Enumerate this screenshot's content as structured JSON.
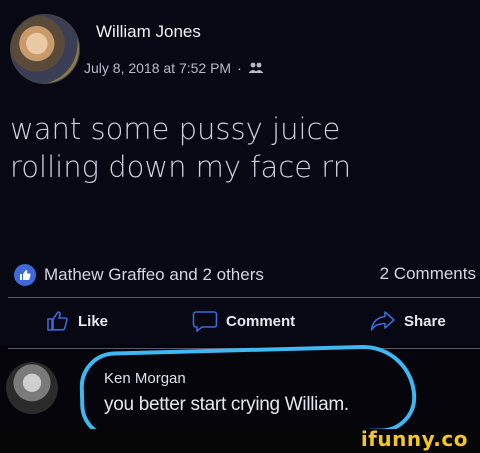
{
  "post": {
    "author": "William Jones",
    "timestamp": "July 8, 2018 at 7:52 PM",
    "separator": "·",
    "audience_icon": "friends-icon",
    "text_line1": "want some pussy juice",
    "text_line2": "rolling down my face rn"
  },
  "reactions": {
    "icon": "like-icon",
    "summary": "Mathew Graffeo and 2 others",
    "comments_count": "2 Comments"
  },
  "actions": {
    "like": "Like",
    "comment": "Comment",
    "share": "Share"
  },
  "comment": {
    "author": "Ken Morgan",
    "text": "you better start crying William."
  },
  "watermark": "ifunny.co",
  "colors": {
    "background": "#080814",
    "like_badge": "#3d6ad6",
    "annotation": "#3fb7f0",
    "watermark": "#f3c623"
  }
}
